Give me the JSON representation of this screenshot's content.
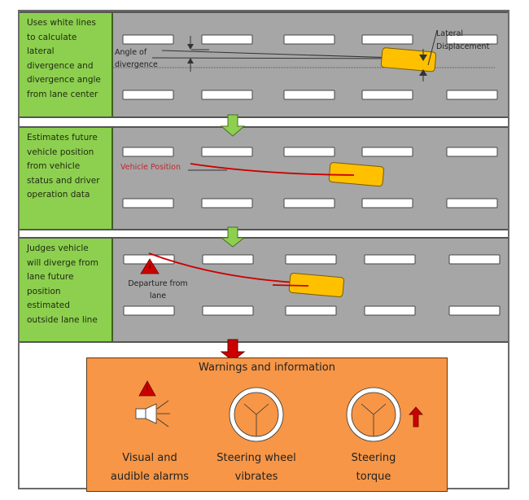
{
  "steps": [
    {
      "description_lines": [
        "Uses white lines",
        "to calculate",
        "lateral",
        "divergence and",
        "divergence angle",
        "from lane center"
      ],
      "annotations": {
        "angle_label_line1": "Angle of",
        "angle_label_line2": "divergence",
        "displacement_label_line1": "Lateral",
        "displacement_label_line2": "Displacement"
      }
    },
    {
      "description_lines": [
        "Estimates  future",
        "vehicle position",
        "from vehicle",
        "status and driver",
        "operation data"
      ],
      "annotations": {
        "vehicle_position_label": "Vehicle Position"
      }
    },
    {
      "description_lines": [
        "Judges vehicle",
        "will diverge from",
        "lane future",
        "position",
        "estimated",
        "outside lane  line"
      ],
      "annotations": {
        "departure_label_line1": "Departure from",
        "departure_label_line2": "lane"
      }
    }
  ],
  "warnings": {
    "title": "Warnings and information",
    "items": [
      {
        "line1": "Visual and",
        "line2": "audible alarms",
        "icon": "warning-speaker-icon"
      },
      {
        "line1": "Steering wheel",
        "line2": "vibrates",
        "icon": "steering-wheel-icon"
      },
      {
        "line1": "Steering",
        "line2": "torque",
        "icon": "steering-wheel-torque-icon"
      }
    ]
  },
  "colors": {
    "step_panel": "#8dd04f",
    "road": "#a6a6a6",
    "vehicle": "#ffc000",
    "trajectory": "#cc0000",
    "flow_arrow_green": "#8dd04f",
    "flow_arrow_red": "#cc0000",
    "warning_box": "#f79646"
  }
}
